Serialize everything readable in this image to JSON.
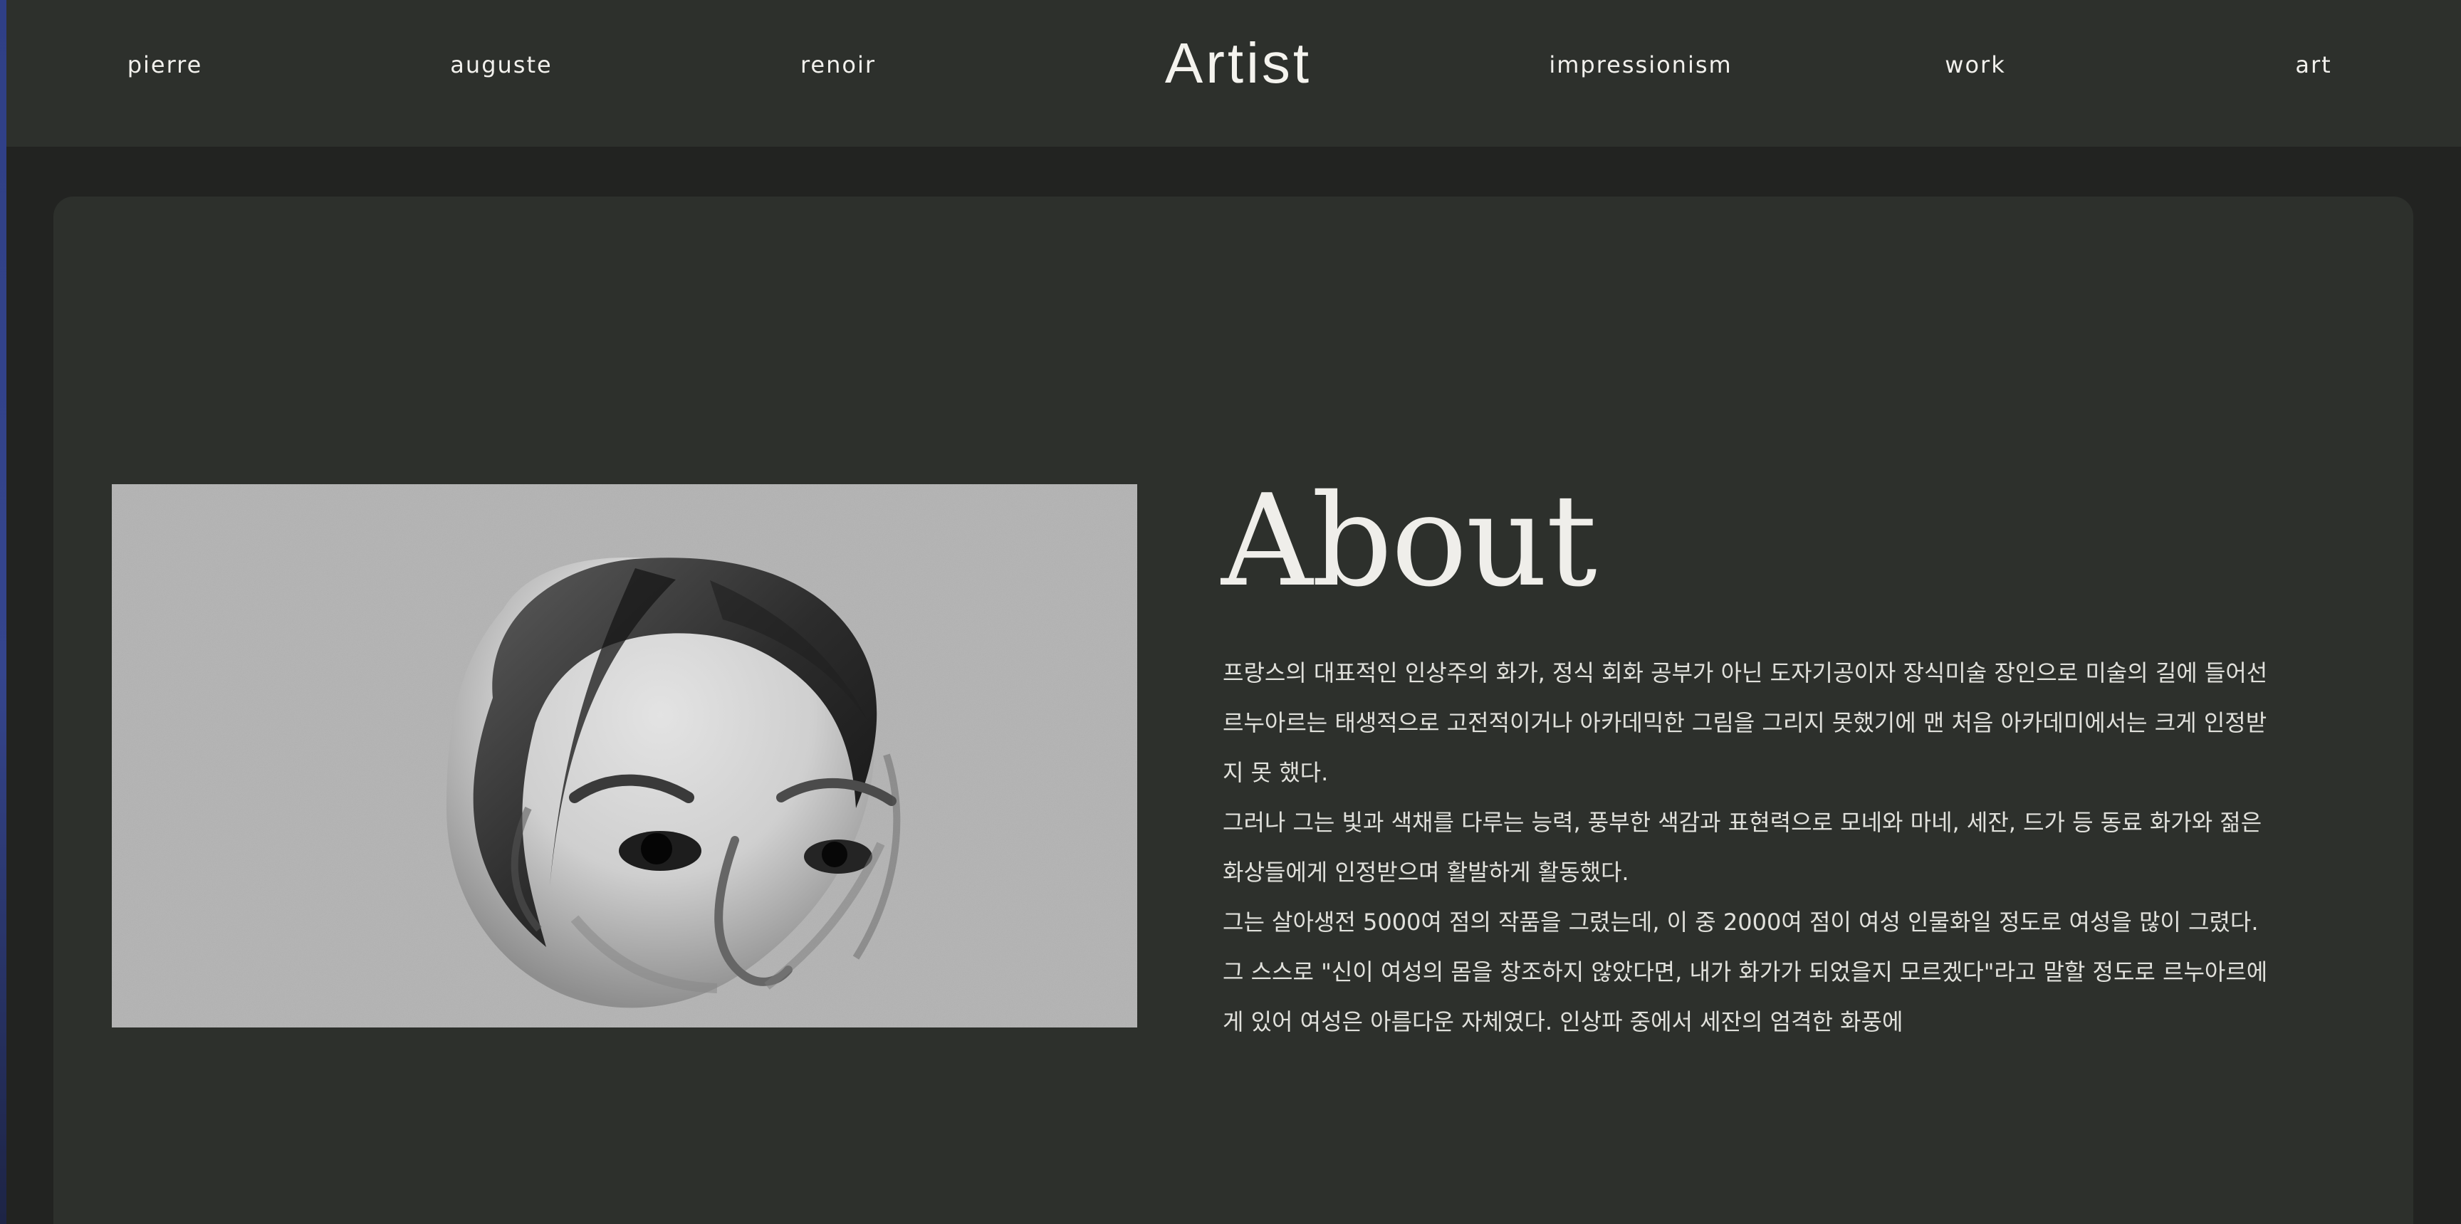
{
  "nav": {
    "items": [
      {
        "label": "pierre"
      },
      {
        "label": "auguste"
      },
      {
        "label": "renoir"
      },
      {
        "label": "impressionism"
      },
      {
        "label": "work"
      },
      {
        "label": "art"
      }
    ],
    "brand": "Artist"
  },
  "about": {
    "title": "About",
    "paragraphs": [
      "프랑스의 대표적인 인상주의 화가, 정식 회화 공부가 아닌 도자기공이자 장식미술 장인으로 미술의 길에 들어선 르누아르는 태생적으로 고전적이거나 아카데믹한 그림을 그리지 못했기에 맨 처음 아카데미에서는 크게 인정받지 못 했다.",
      "그러나 그는 빛과 색채를 다루는 능력, 풍부한 색감과 표현력으로 모네와 마네, 세잔, 드가 등 동료 화가와 젊은 화상들에게 인정받으며 활발하게 활동했다.",
      "그는 살아생전 5000여 점의 작품을 그렸는데, 이 중 2000여 점이 여성 인물화일 정도로 여성을 많이 그렸다. 그 스스로 \"신이 여성의 몸을 창조하지 않았다면, 내가 화가가 되었을지 모르겠다\"라고 말할 정도로 르누아르에게 있어 여성은 아름다운 자체였다. 인상파 중에서 세잔의 엄격한 화풍에"
    ]
  },
  "colors": {
    "topbar": "#2d302c",
    "background": "#222321",
    "card": "#2d302c",
    "text": "#efeeea"
  }
}
